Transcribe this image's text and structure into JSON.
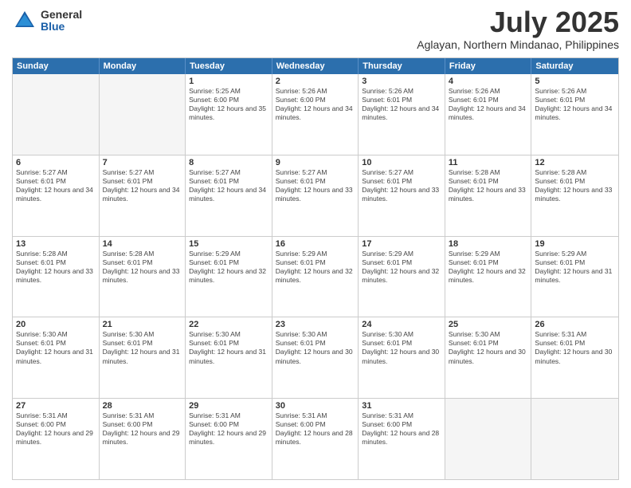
{
  "logo": {
    "general": "General",
    "blue": "Blue"
  },
  "title": "July 2025",
  "location": "Aglayan, Northern Mindanao, Philippines",
  "header_days": [
    "Sunday",
    "Monday",
    "Tuesday",
    "Wednesday",
    "Thursday",
    "Friday",
    "Saturday"
  ],
  "weeks": [
    [
      {
        "day": "",
        "empty": true
      },
      {
        "day": "",
        "empty": true
      },
      {
        "day": "1",
        "sunrise": "5:25 AM",
        "sunset": "6:00 PM",
        "daylight": "12 hours and 35 minutes."
      },
      {
        "day": "2",
        "sunrise": "5:26 AM",
        "sunset": "6:00 PM",
        "daylight": "12 hours and 34 minutes."
      },
      {
        "day": "3",
        "sunrise": "5:26 AM",
        "sunset": "6:01 PM",
        "daylight": "12 hours and 34 minutes."
      },
      {
        "day": "4",
        "sunrise": "5:26 AM",
        "sunset": "6:01 PM",
        "daylight": "12 hours and 34 minutes."
      },
      {
        "day": "5",
        "sunrise": "5:26 AM",
        "sunset": "6:01 PM",
        "daylight": "12 hours and 34 minutes."
      }
    ],
    [
      {
        "day": "6",
        "sunrise": "5:27 AM",
        "sunset": "6:01 PM",
        "daylight": "12 hours and 34 minutes."
      },
      {
        "day": "7",
        "sunrise": "5:27 AM",
        "sunset": "6:01 PM",
        "daylight": "12 hours and 34 minutes."
      },
      {
        "day": "8",
        "sunrise": "5:27 AM",
        "sunset": "6:01 PM",
        "daylight": "12 hours and 34 minutes."
      },
      {
        "day": "9",
        "sunrise": "5:27 AM",
        "sunset": "6:01 PM",
        "daylight": "12 hours and 33 minutes."
      },
      {
        "day": "10",
        "sunrise": "5:27 AM",
        "sunset": "6:01 PM",
        "daylight": "12 hours and 33 minutes."
      },
      {
        "day": "11",
        "sunrise": "5:28 AM",
        "sunset": "6:01 PM",
        "daylight": "12 hours and 33 minutes."
      },
      {
        "day": "12",
        "sunrise": "5:28 AM",
        "sunset": "6:01 PM",
        "daylight": "12 hours and 33 minutes."
      }
    ],
    [
      {
        "day": "13",
        "sunrise": "5:28 AM",
        "sunset": "6:01 PM",
        "daylight": "12 hours and 33 minutes."
      },
      {
        "day": "14",
        "sunrise": "5:28 AM",
        "sunset": "6:01 PM",
        "daylight": "12 hours and 33 minutes."
      },
      {
        "day": "15",
        "sunrise": "5:29 AM",
        "sunset": "6:01 PM",
        "daylight": "12 hours and 32 minutes."
      },
      {
        "day": "16",
        "sunrise": "5:29 AM",
        "sunset": "6:01 PM",
        "daylight": "12 hours and 32 minutes."
      },
      {
        "day": "17",
        "sunrise": "5:29 AM",
        "sunset": "6:01 PM",
        "daylight": "12 hours and 32 minutes."
      },
      {
        "day": "18",
        "sunrise": "5:29 AM",
        "sunset": "6:01 PM",
        "daylight": "12 hours and 32 minutes."
      },
      {
        "day": "19",
        "sunrise": "5:29 AM",
        "sunset": "6:01 PM",
        "daylight": "12 hours and 31 minutes."
      }
    ],
    [
      {
        "day": "20",
        "sunrise": "5:30 AM",
        "sunset": "6:01 PM",
        "daylight": "12 hours and 31 minutes."
      },
      {
        "day": "21",
        "sunrise": "5:30 AM",
        "sunset": "6:01 PM",
        "daylight": "12 hours and 31 minutes."
      },
      {
        "day": "22",
        "sunrise": "5:30 AM",
        "sunset": "6:01 PM",
        "daylight": "12 hours and 31 minutes."
      },
      {
        "day": "23",
        "sunrise": "5:30 AM",
        "sunset": "6:01 PM",
        "daylight": "12 hours and 30 minutes."
      },
      {
        "day": "24",
        "sunrise": "5:30 AM",
        "sunset": "6:01 PM",
        "daylight": "12 hours and 30 minutes."
      },
      {
        "day": "25",
        "sunrise": "5:30 AM",
        "sunset": "6:01 PM",
        "daylight": "12 hours and 30 minutes."
      },
      {
        "day": "26",
        "sunrise": "5:31 AM",
        "sunset": "6:01 PM",
        "daylight": "12 hours and 30 minutes."
      }
    ],
    [
      {
        "day": "27",
        "sunrise": "5:31 AM",
        "sunset": "6:00 PM",
        "daylight": "12 hours and 29 minutes."
      },
      {
        "day": "28",
        "sunrise": "5:31 AM",
        "sunset": "6:00 PM",
        "daylight": "12 hours and 29 minutes."
      },
      {
        "day": "29",
        "sunrise": "5:31 AM",
        "sunset": "6:00 PM",
        "daylight": "12 hours and 29 minutes."
      },
      {
        "day": "30",
        "sunrise": "5:31 AM",
        "sunset": "6:00 PM",
        "daylight": "12 hours and 28 minutes."
      },
      {
        "day": "31",
        "sunrise": "5:31 AM",
        "sunset": "6:00 PM",
        "daylight": "12 hours and 28 minutes."
      },
      {
        "day": "",
        "empty": true
      },
      {
        "day": "",
        "empty": true
      }
    ]
  ]
}
